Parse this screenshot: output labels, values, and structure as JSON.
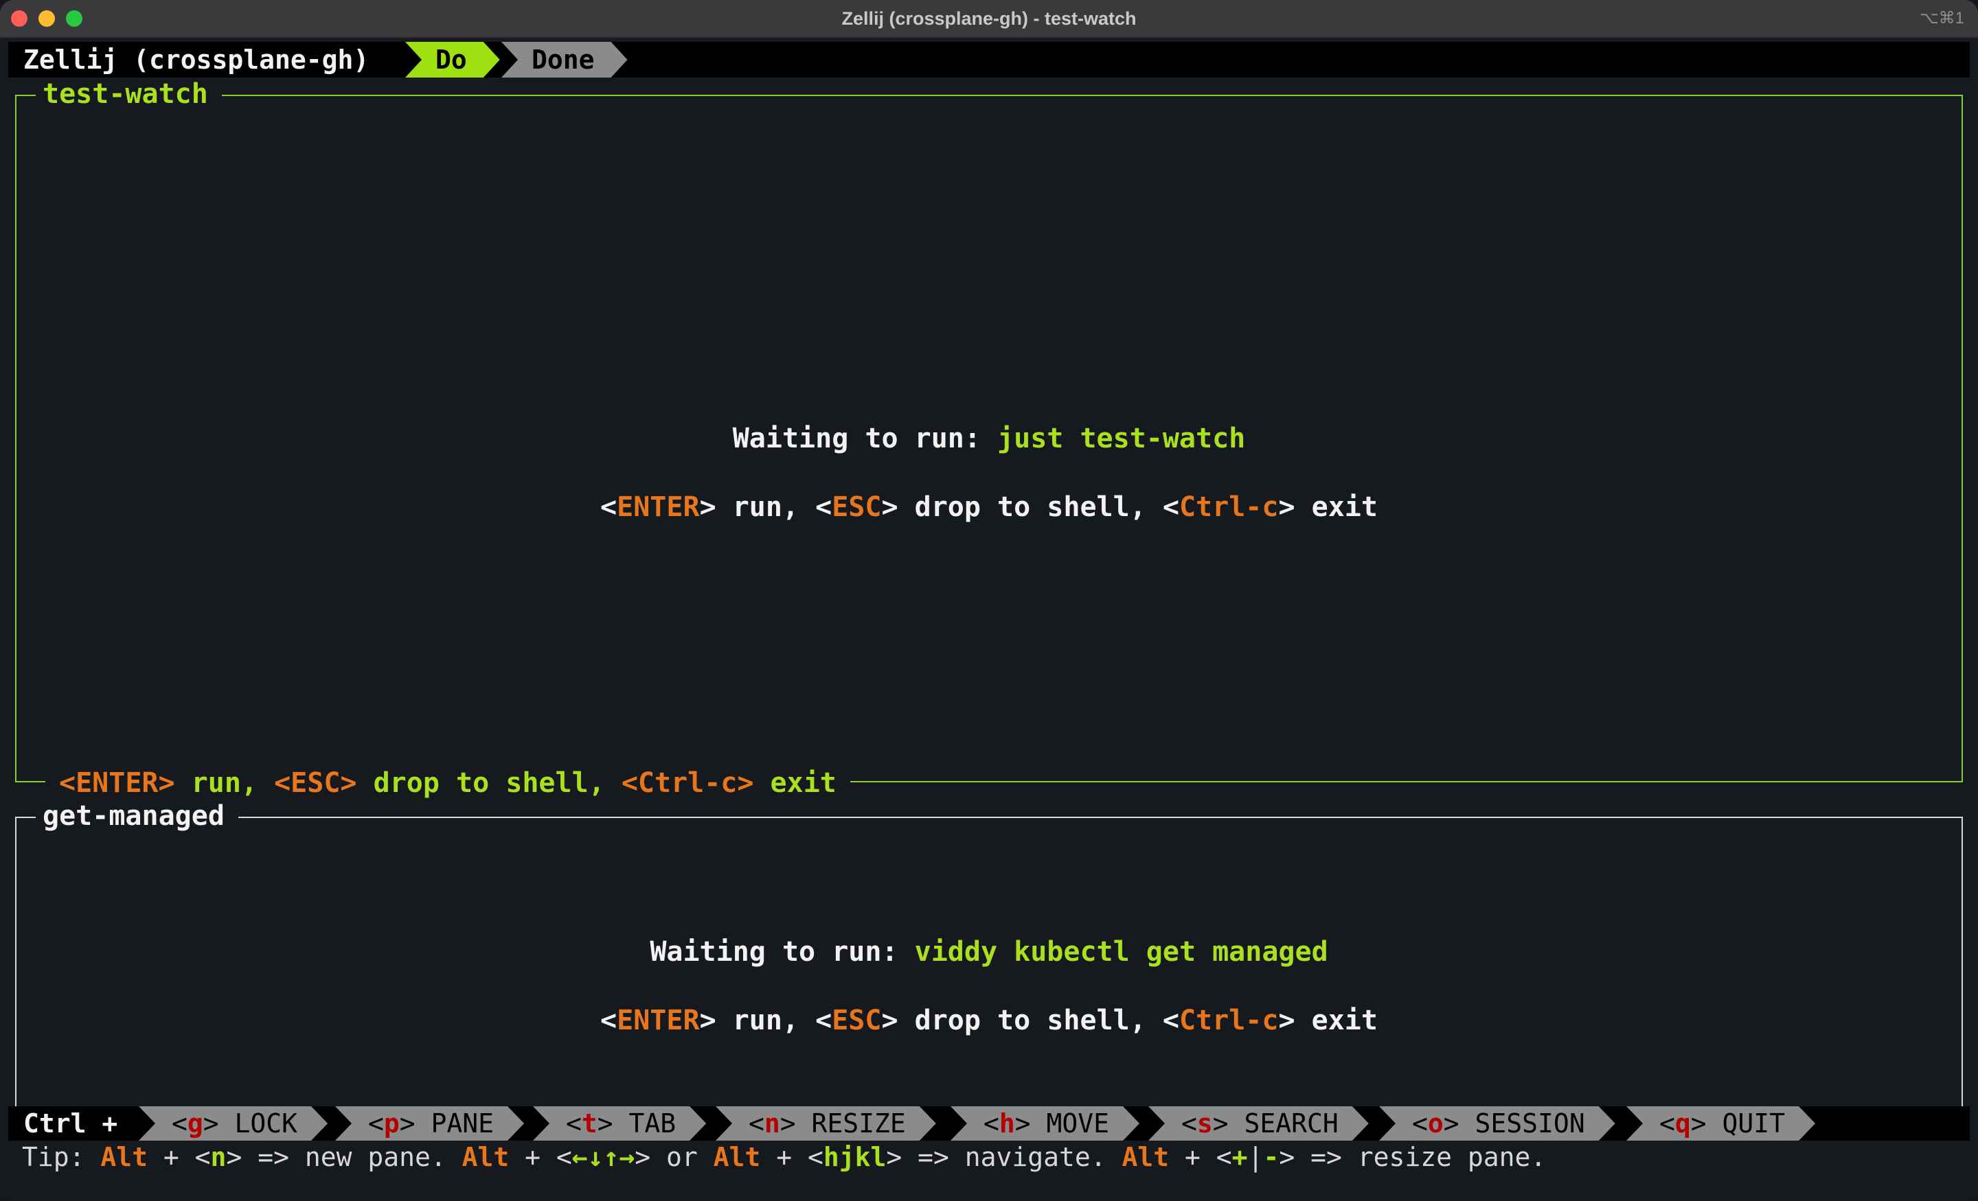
{
  "window": {
    "title": "Zellij (crossplane-gh) - test-watch",
    "shortcut": "⌥⌘1"
  },
  "tabbar": {
    "session": "Zellij (crossplane-gh)",
    "tabs": [
      {
        "label": "Do",
        "active": true
      },
      {
        "label": "Done",
        "active": false
      }
    ]
  },
  "panes": {
    "top": {
      "title": "test-watch",
      "waiting_prefix": "Waiting to run: ",
      "command": "just test-watch",
      "footer": {
        "k1": "<ENTER>",
        "a1": " run, ",
        "k2": "<ESC>",
        "a2": " drop to shell, ",
        "k3": "<Ctrl-c>",
        "a3": " exit"
      }
    },
    "bottom": {
      "title": "get-managed",
      "waiting_prefix": "Waiting to run: ",
      "command": "viddy kubectl get managed"
    },
    "hint": {
      "lt": "<",
      "k1": "ENTER",
      "a1": "> run, <",
      "k2": "ESC",
      "a2": "> drop to shell, <",
      "k3": "Ctrl-c",
      "a3": "> exit"
    }
  },
  "statusbar": {
    "prefix": "Ctrl +",
    "keys": [
      {
        "key": "g",
        "label": "LOCK"
      },
      {
        "key": "p",
        "label": "PANE"
      },
      {
        "key": "t",
        "label": "TAB"
      },
      {
        "key": "n",
        "label": "RESIZE"
      },
      {
        "key": "h",
        "label": "MOVE"
      },
      {
        "key": "s",
        "label": "SEARCH"
      },
      {
        "key": "o",
        "label": "SESSION"
      },
      {
        "key": "q",
        "label": "QUIT"
      }
    ]
  },
  "tip": {
    "t0": "Tip: ",
    "alt": "Alt",
    "t1": " + <",
    "n": "n",
    "t2": "> => new pane. ",
    "t3": " + <",
    "arrows": "←↓↑→",
    "t4": "> or ",
    "t5": " + <",
    "hjkl": "hjkl",
    "t6": "> => navigate. ",
    "t7": " + <",
    "plus": "+",
    "bar": "|",
    "minus": "-",
    "t8": "> => resize pane."
  },
  "colors": {
    "accent_green": "#a9e020",
    "key_orange": "#e8761d",
    "key_red": "#b30000",
    "pane_border_active": "#84d12a"
  }
}
